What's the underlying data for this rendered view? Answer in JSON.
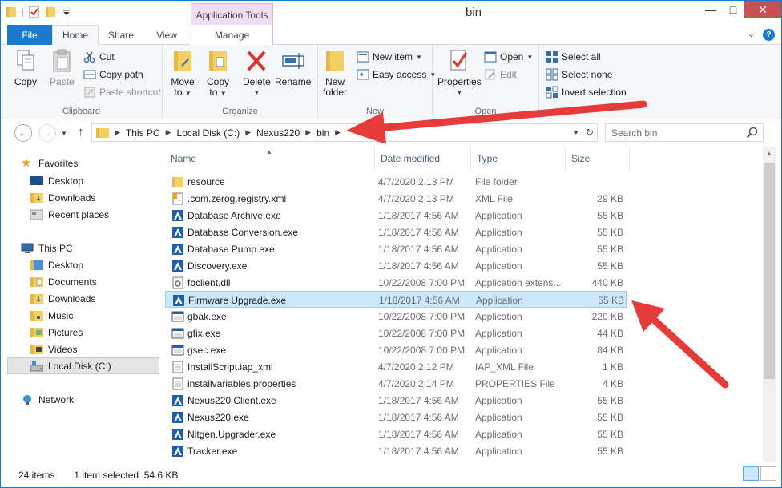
{
  "window": {
    "title": "bin",
    "context_tab_header": "Application Tools"
  },
  "tabs": {
    "file": "File",
    "home": "Home",
    "share": "Share",
    "view": "View",
    "manage": "Manage"
  },
  "ribbon": {
    "clipboard": {
      "label": "Clipboard",
      "copy": "Copy",
      "paste": "Paste",
      "cut": "Cut",
      "copy_path": "Copy path",
      "paste_shortcut": "Paste shortcut"
    },
    "organize": {
      "label": "Organize",
      "move_to_1": "Move",
      "move_to_2": "to",
      "copy_to_1": "Copy",
      "copy_to_2": "to",
      "delete": "Delete",
      "rename": "Rename"
    },
    "new": {
      "label": "New",
      "new_folder_1": "New",
      "new_folder_2": "folder",
      "new_item": "New item",
      "easy_access": "Easy access"
    },
    "open": {
      "label": "Open",
      "properties": "Properties",
      "open": "Open",
      "edit": "Edit"
    },
    "select": {
      "select_all": "Select all",
      "select_none": "Select none",
      "invert_selection": "Invert selection"
    }
  },
  "address": {
    "crumbs": [
      "This PC",
      "Local Disk (C:)",
      "Nexus220",
      "bin"
    ],
    "search_placeholder": "Search bin"
  },
  "nav": {
    "favorites": "Favorites",
    "fav_items": [
      "Desktop",
      "Downloads",
      "Recent places"
    ],
    "this_pc": "This PC",
    "pc_items": [
      "Desktop",
      "Documents",
      "Downloads",
      "Music",
      "Pictures",
      "Videos",
      "Local Disk (C:)"
    ],
    "network": "Network"
  },
  "columns": {
    "name": "Name",
    "date": "Date modified",
    "type": "Type",
    "size": "Size"
  },
  "files": [
    {
      "name": "resource",
      "date": "4/7/2020 2:13 PM",
      "type": "File folder",
      "size": "",
      "icon": "folder-icon"
    },
    {
      "name": ".com.zerog.registry.xml",
      "date": "4/7/2020 2:13 PM",
      "type": "XML File",
      "size": "29 KB",
      "icon": "xml-file-icon"
    },
    {
      "name": "Database Archive.exe",
      "date": "1/18/2017 4:56 AM",
      "type": "Application",
      "size": "55 KB",
      "icon": "app-icon"
    },
    {
      "name": "Database Conversion.exe",
      "date": "1/18/2017 4:56 AM",
      "type": "Application",
      "size": "55 KB",
      "icon": "app-icon"
    },
    {
      "name": "Database Pump.exe",
      "date": "1/18/2017 4:56 AM",
      "type": "Application",
      "size": "55 KB",
      "icon": "app-icon"
    },
    {
      "name": "Discovery.exe",
      "date": "1/18/2017 4:56 AM",
      "type": "Application",
      "size": "55 KB",
      "icon": "app-icon"
    },
    {
      "name": "fbclient.dll",
      "date": "10/22/2008 7:00 PM",
      "type": "Application extens...",
      "size": "440 KB",
      "icon": "dll-icon"
    },
    {
      "name": "Firmware Upgrade.exe",
      "date": "1/18/2017 4:56 AM",
      "type": "Application",
      "size": "55 KB",
      "icon": "app-icon"
    },
    {
      "name": "gbak.exe",
      "date": "10/22/2008 7:00 PM",
      "type": "Application",
      "size": "220 KB",
      "icon": "console-app-icon"
    },
    {
      "name": "gfix.exe",
      "date": "10/22/2008 7:00 PM",
      "type": "Application",
      "size": "44 KB",
      "icon": "console-app-icon"
    },
    {
      "name": "gsec.exe",
      "date": "10/22/2008 7:00 PM",
      "type": "Application",
      "size": "84 KB",
      "icon": "console-app-icon"
    },
    {
      "name": "InstallScript.iap_xml",
      "date": "4/7/2020 2:12 PM",
      "type": "IAP_XML File",
      "size": "1 KB",
      "icon": "generic-file-icon"
    },
    {
      "name": "installvariables.properties",
      "date": "4/7/2020 2:14 PM",
      "type": "PROPERTIES File",
      "size": "4 KB",
      "icon": "generic-file-icon"
    },
    {
      "name": "Nexus220 Client.exe",
      "date": "1/18/2017 4:56 AM",
      "type": "Application",
      "size": "55 KB",
      "icon": "app-icon"
    },
    {
      "name": "Nexus220.exe",
      "date": "1/18/2017 4:56 AM",
      "type": "Application",
      "size": "55 KB",
      "icon": "app-icon"
    },
    {
      "name": "Nitgen.Upgrader.exe",
      "date": "1/18/2017 4:56 AM",
      "type": "Application",
      "size": "55 KB",
      "icon": "app-icon"
    },
    {
      "name": "Tracker.exe",
      "date": "1/18/2017 4:56 AM",
      "type": "Application",
      "size": "55 KB",
      "icon": "app-icon"
    }
  ],
  "selected_index": 7,
  "status": {
    "items": "24 items",
    "selected": "1 item selected  54.6 KB"
  },
  "colors": {
    "accent": "#1979ca",
    "selection": "#cce8ff",
    "annotation_arrow": "#e63b3b",
    "context_tab": "#f1def6"
  }
}
